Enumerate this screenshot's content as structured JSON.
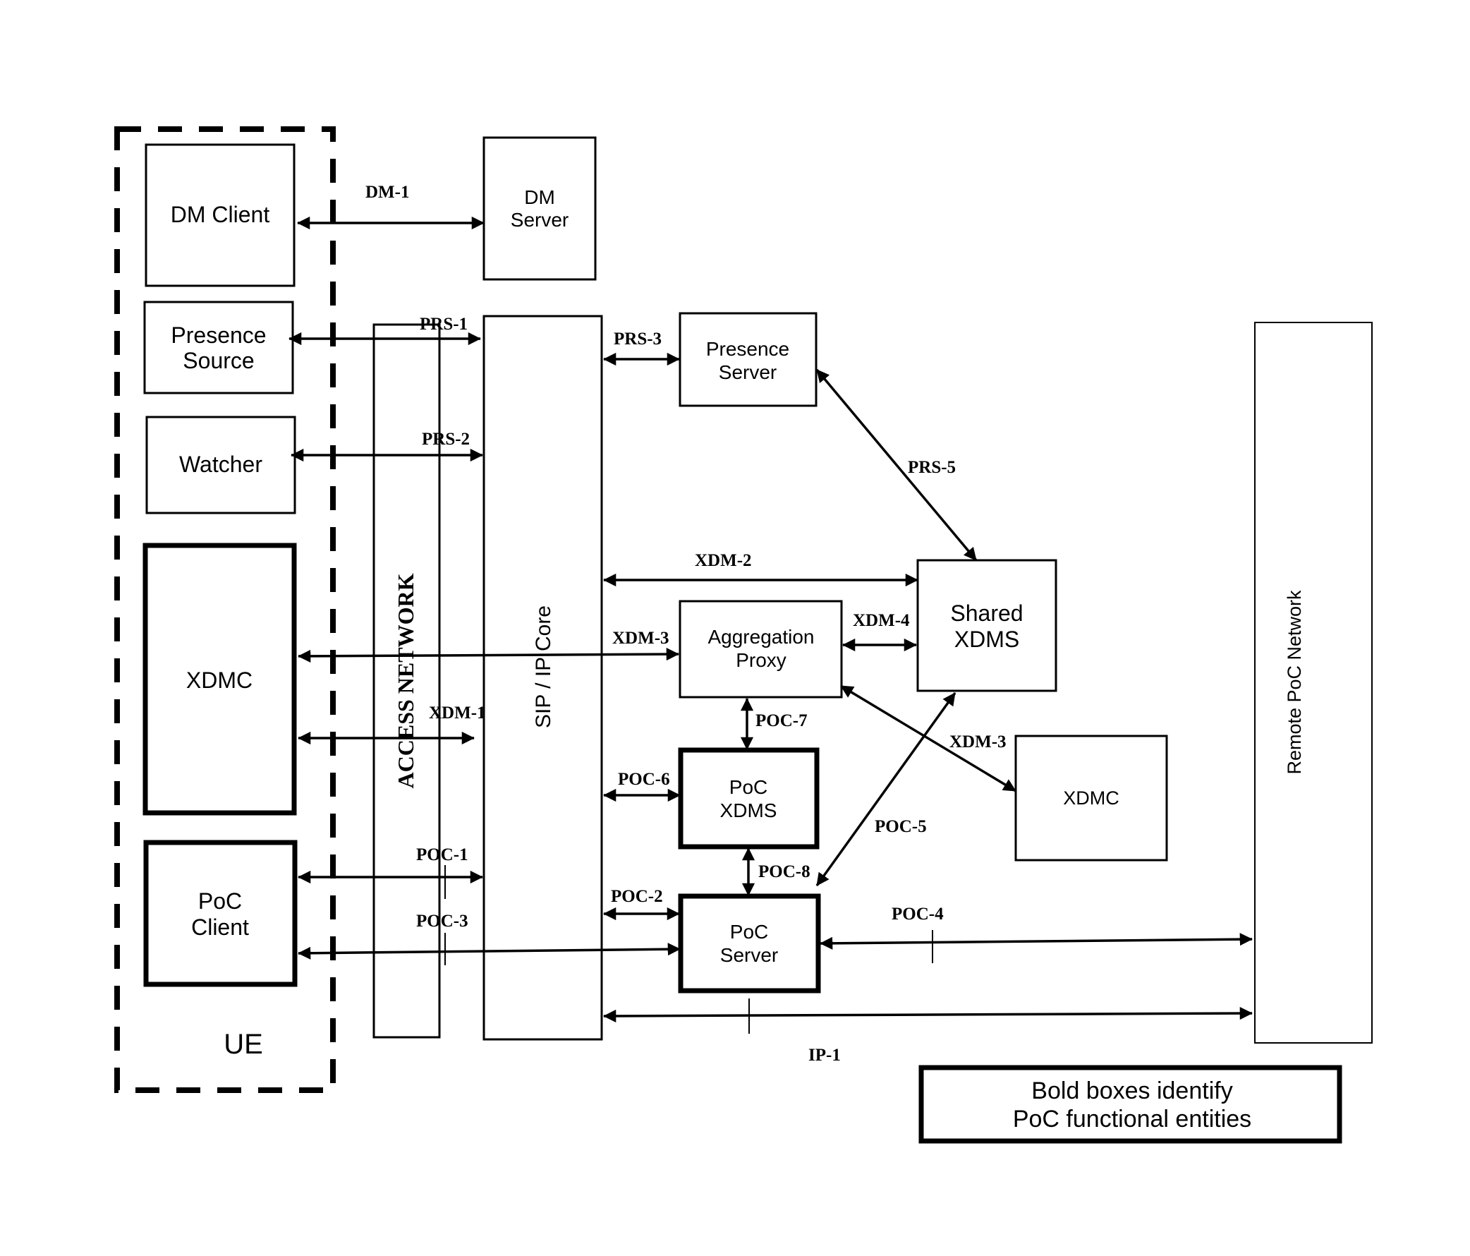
{
  "diagram": {
    "ue": {
      "label": "UE"
    },
    "entities": {
      "dm_client": [
        "DM Client"
      ],
      "dm_server": [
        "DM",
        "Server"
      ],
      "presence_source": [
        "Presence",
        "Source"
      ],
      "watcher": [
        "Watcher"
      ],
      "xdmc_ue": [
        "XDMC"
      ],
      "poc_client": [
        "PoC",
        "Client"
      ],
      "access_network": "ACCESS NETWORK",
      "sip_ip_core": "SIP / IP Core",
      "presence_server": [
        "Presence",
        "Server"
      ],
      "aggregation_proxy": [
        "Aggregation",
        "Proxy"
      ],
      "shared_xdms": [
        "Shared",
        "XDMS"
      ],
      "poc_xdms": [
        "PoC",
        "XDMS"
      ],
      "poc_server": [
        "PoC",
        "Server"
      ],
      "xdmc_remote": [
        "XDMC"
      ],
      "remote_poc_network": "Remote PoC Network"
    },
    "interfaces": {
      "dm1": "DM-1",
      "prs1": "PRS-1",
      "prs2": "PRS-2",
      "prs3": "PRS-3",
      "prs5": "PRS-5",
      "xdm1": "XDM-1",
      "xdm2": "XDM-2",
      "xdm3_left": "XDM-3",
      "xdm3_right": "XDM-3",
      "xdm4": "XDM-4",
      "poc1": "POC-1",
      "poc2": "POC-2",
      "poc3": "POC-3",
      "poc4": "POC-4",
      "poc5": "POC-5",
      "poc6": "POC-6",
      "poc7": "POC-7",
      "poc8": "POC-8",
      "ip1": "IP-1"
    },
    "legend": [
      "Bold boxes identify",
      "PoC functional entities"
    ]
  }
}
